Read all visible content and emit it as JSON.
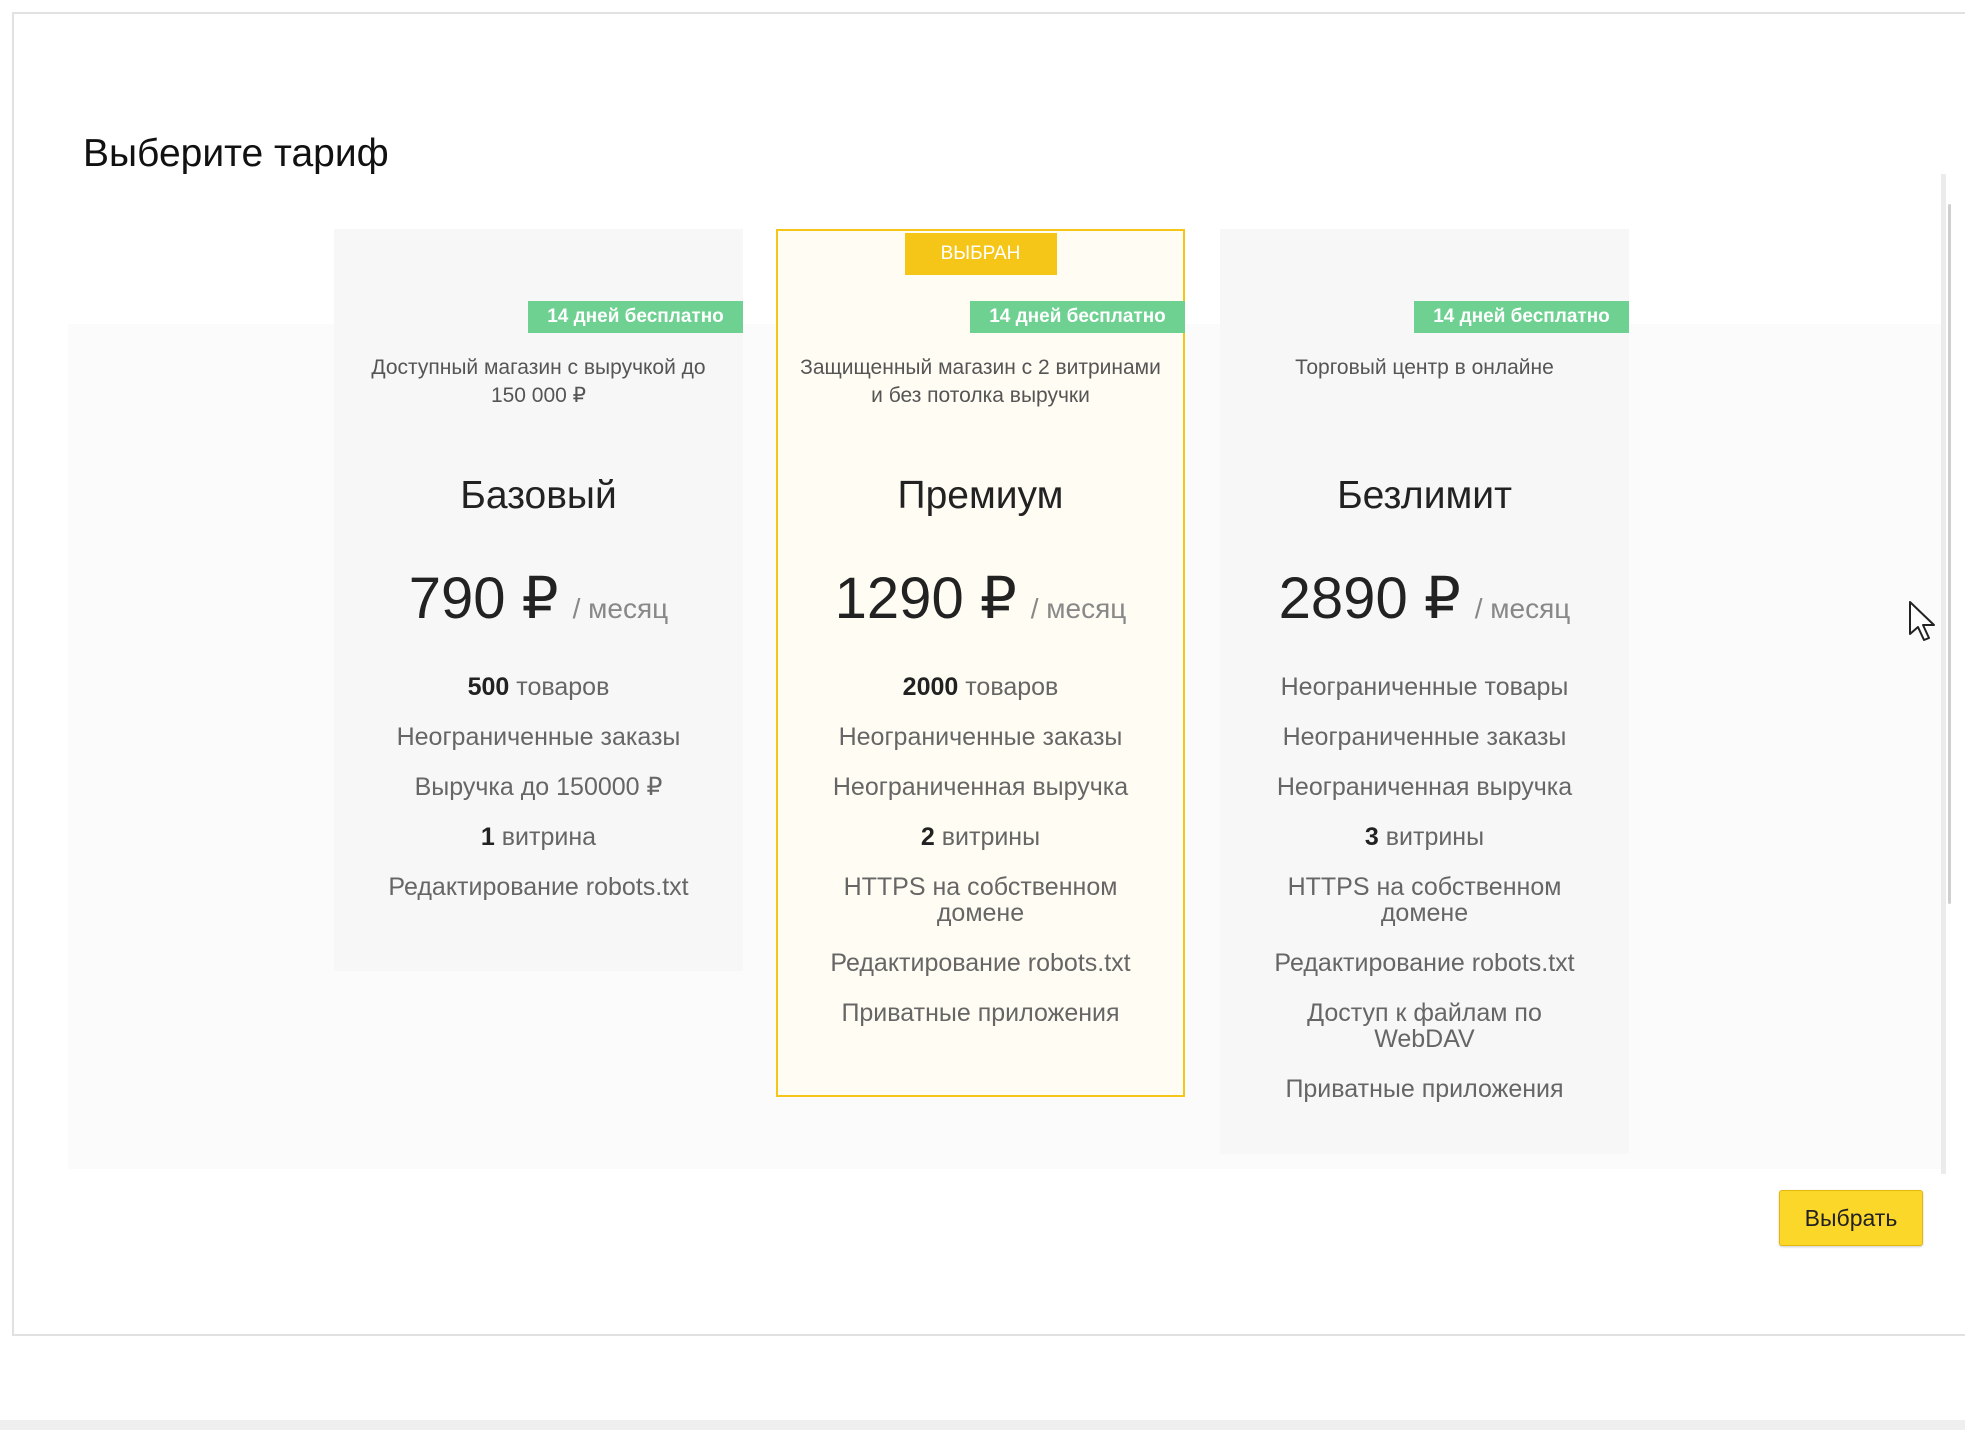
{
  "dialog": {
    "title": "Выберите тариф"
  },
  "plans": [
    {
      "name": "Базовый",
      "trial": "14 дней бесплатно",
      "description": "Доступный магазин с выручкой до 150 000 ₽",
      "price": "790 ₽",
      "period": "/ месяц",
      "features": [
        {
          "bold": "500",
          "text": " товаров"
        },
        {
          "bold": "",
          "text": "Неограниченные заказы"
        },
        {
          "bold": "",
          "text": "Выручка до 150000 ₽"
        },
        {
          "bold": "1",
          "text": " витрина"
        },
        {
          "bold": "",
          "text": "Редактирование robots.txt"
        }
      ]
    },
    {
      "name": "Премиум",
      "selected_label": "ВЫБРАН",
      "trial": "14 дней бесплатно",
      "description": "Защищенный магазин с 2 витринами и без потолка выручки",
      "price": "1290 ₽",
      "period": "/ месяц",
      "features": [
        {
          "bold": "2000",
          "text": " товаров"
        },
        {
          "bold": "",
          "text": "Неограниченные заказы"
        },
        {
          "bold": "",
          "text": "Неограниченная выручка"
        },
        {
          "bold": "2",
          "text": " витрины"
        },
        {
          "bold": "",
          "text": "HTTPS на собственном домене"
        },
        {
          "bold": "",
          "text": "Редактирование robots.txt"
        },
        {
          "bold": "",
          "text": "Приватные приложения"
        }
      ]
    },
    {
      "name": "Безлимит",
      "trial": "14 дней бесплатно",
      "description": "Торговый центр в онлайне",
      "price": "2890 ₽",
      "period": "/ месяц",
      "features": [
        {
          "bold": "",
          "text": "Неограниченные товары"
        },
        {
          "bold": "",
          "text": "Неограниченные заказы"
        },
        {
          "bold": "",
          "text": "Неограниченная выручка"
        },
        {
          "bold": "3",
          "text": " витрины"
        },
        {
          "bold": "",
          "text": "HTTPS на собственном домене"
        },
        {
          "bold": "",
          "text": "Редактирование robots.txt"
        },
        {
          "bold": "",
          "text": "Доступ к файлам по WebDAV"
        },
        {
          "bold": "",
          "text": "Приватные приложения"
        }
      ]
    }
  ],
  "actions": {
    "choose_label": "Выбрать"
  },
  "colors": {
    "accent_yellow": "#f5c518",
    "button_yellow": "#fbd72a",
    "trial_green": "#6ed091",
    "selected_card_bg": "#fffdf3"
  },
  "icons": {
    "cursor": "mouse-pointer-icon"
  }
}
